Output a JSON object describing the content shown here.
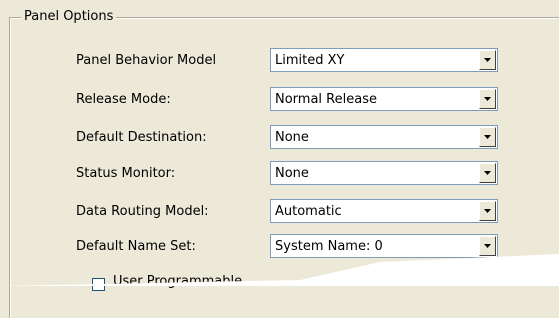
{
  "group": {
    "title": "Panel Options"
  },
  "fields": [
    {
      "label": "Panel Behavior Model",
      "value": "Limited XY"
    },
    {
      "label": "Release Mode:",
      "value": "Normal Release"
    },
    {
      "label": "Default Destination:",
      "value": "None"
    },
    {
      "label": "Status Monitor:",
      "value": "None"
    },
    {
      "label": "Data Routing Model:",
      "value": "Automatic"
    },
    {
      "label": "Default Name Set:",
      "value": "System Name: 0"
    }
  ],
  "checkbox": {
    "label": "User Programmable",
    "checked": false
  }
}
